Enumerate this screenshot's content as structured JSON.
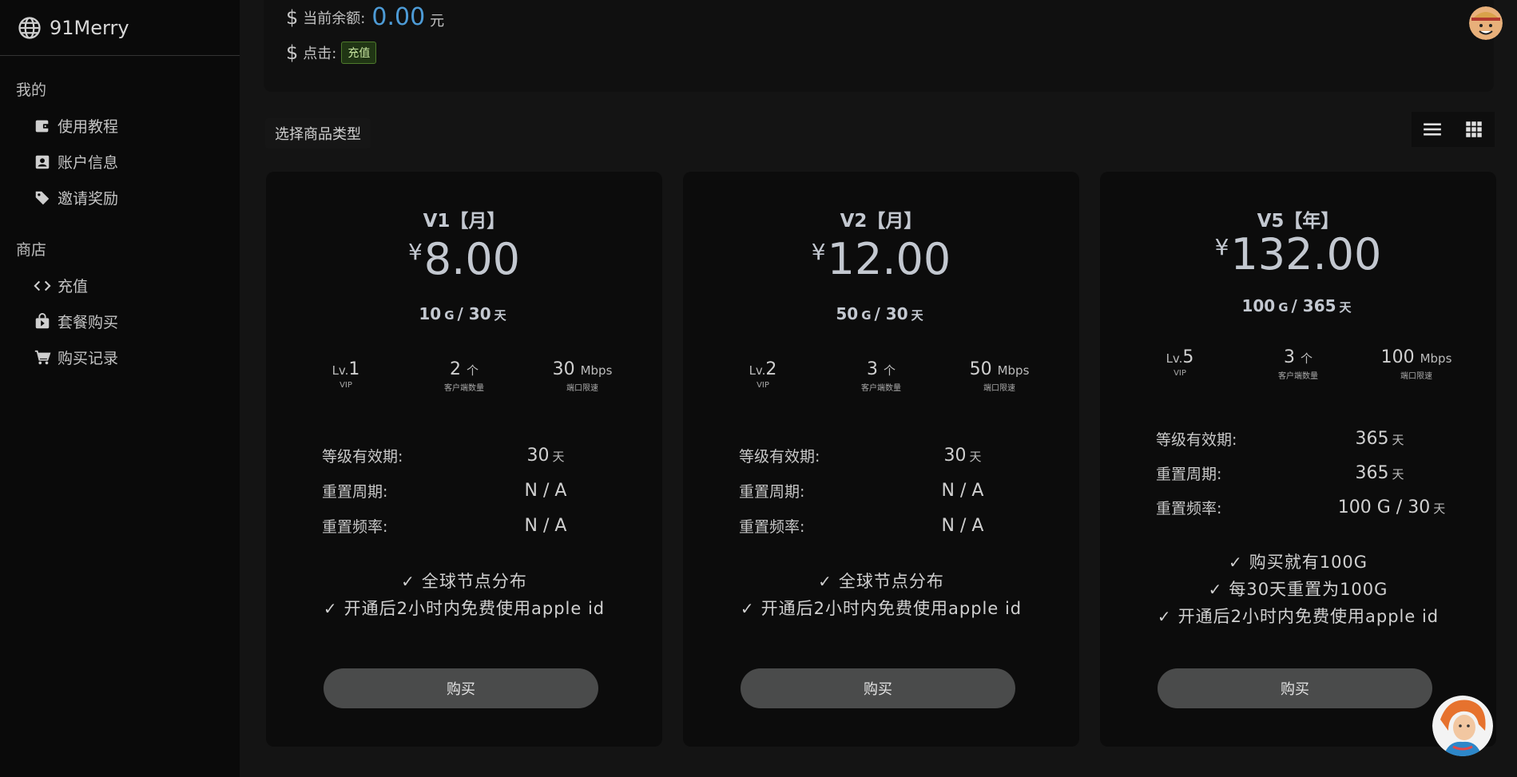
{
  "brand": {
    "name": "91Merry"
  },
  "sidebar": {
    "sections": [
      {
        "title": "我的",
        "items": [
          {
            "label": "使用教程",
            "icon": "wallet-icon"
          },
          {
            "label": "账户信息",
            "icon": "contact-card-icon"
          },
          {
            "label": "邀请奖励",
            "icon": "tag-icon"
          }
        ]
      },
      {
        "title": "商店",
        "items": [
          {
            "label": "充值",
            "icon": "code-icon"
          },
          {
            "label": "套餐购买",
            "icon": "shopping-bag-icon"
          },
          {
            "label": "购买记录",
            "icon": "cart-icon"
          }
        ]
      }
    ]
  },
  "balance": {
    "label": "当前余额:",
    "amount": "0.00",
    "unit": "元",
    "click_label": "点击:",
    "recharge_badge": "充值"
  },
  "section_title": "选择商品类型",
  "view_toggle": [
    "list-view-icon",
    "grid-view-icon"
  ],
  "products": [
    {
      "title": "V1【月】",
      "currency": "¥",
      "price": "8.00",
      "quota_amount": "10",
      "quota_unit": "G",
      "quota_days": "30",
      "days_unit": "天",
      "stats": [
        {
          "prefix": "Lv.",
          "value": "1",
          "suffix": "",
          "caption": "VIP"
        },
        {
          "prefix": "",
          "value": "2",
          "suffix": "个",
          "caption": "客户端数量"
        },
        {
          "prefix": "",
          "value": "30",
          "suffix": "Mbps",
          "caption": "端口限速"
        }
      ],
      "details": [
        {
          "key": "等级有效期:",
          "value": "30",
          "suffix": "天"
        },
        {
          "key": "重置周期:",
          "value": "N / A",
          "suffix": ""
        },
        {
          "key": "重置频率:",
          "value": "N / A",
          "suffix": ""
        }
      ],
      "features": [
        "全球节点分布",
        "开通后2小时内免费使用apple id"
      ],
      "buy_label": "购买"
    },
    {
      "title": "V2【月】",
      "currency": "¥",
      "price": "12.00",
      "quota_amount": "50",
      "quota_unit": "G",
      "quota_days": "30",
      "days_unit": "天",
      "stats": [
        {
          "prefix": "Lv.",
          "value": "2",
          "suffix": "",
          "caption": "VIP"
        },
        {
          "prefix": "",
          "value": "3",
          "suffix": "个",
          "caption": "客户端数量"
        },
        {
          "prefix": "",
          "value": "50",
          "suffix": "Mbps",
          "caption": "端口限速"
        }
      ],
      "details": [
        {
          "key": "等级有效期:",
          "value": "30",
          "suffix": "天"
        },
        {
          "key": "重置周期:",
          "value": "N / A",
          "suffix": ""
        },
        {
          "key": "重置频率:",
          "value": "N / A",
          "suffix": ""
        }
      ],
      "features": [
        "全球节点分布",
        "开通后2小时内免费使用apple id"
      ],
      "buy_label": "购买"
    },
    {
      "title": "V5【年】",
      "currency": "¥",
      "price": "132.00",
      "quota_amount": "100",
      "quota_unit": "G",
      "quota_days": "365",
      "days_unit": "天",
      "stats": [
        {
          "prefix": "Lv.",
          "value": "5",
          "suffix": "",
          "caption": "VIP"
        },
        {
          "prefix": "",
          "value": "3",
          "suffix": "个",
          "caption": "客户端数量"
        },
        {
          "prefix": "",
          "value": "100",
          "suffix": "Mbps",
          "caption": "端口限速"
        }
      ],
      "details": [
        {
          "key": "等级有效期:",
          "value": "365",
          "suffix": "天"
        },
        {
          "key": "重置周期:",
          "value": "365",
          "suffix": "天"
        },
        {
          "key": "重置频率:",
          "value": "100 G / 30",
          "suffix": "天"
        }
      ],
      "features": [
        "购买就有100G",
        "每30天重置为100G",
        "开通后2小时内免费使用apple id"
      ],
      "buy_label": "购买"
    }
  ]
}
